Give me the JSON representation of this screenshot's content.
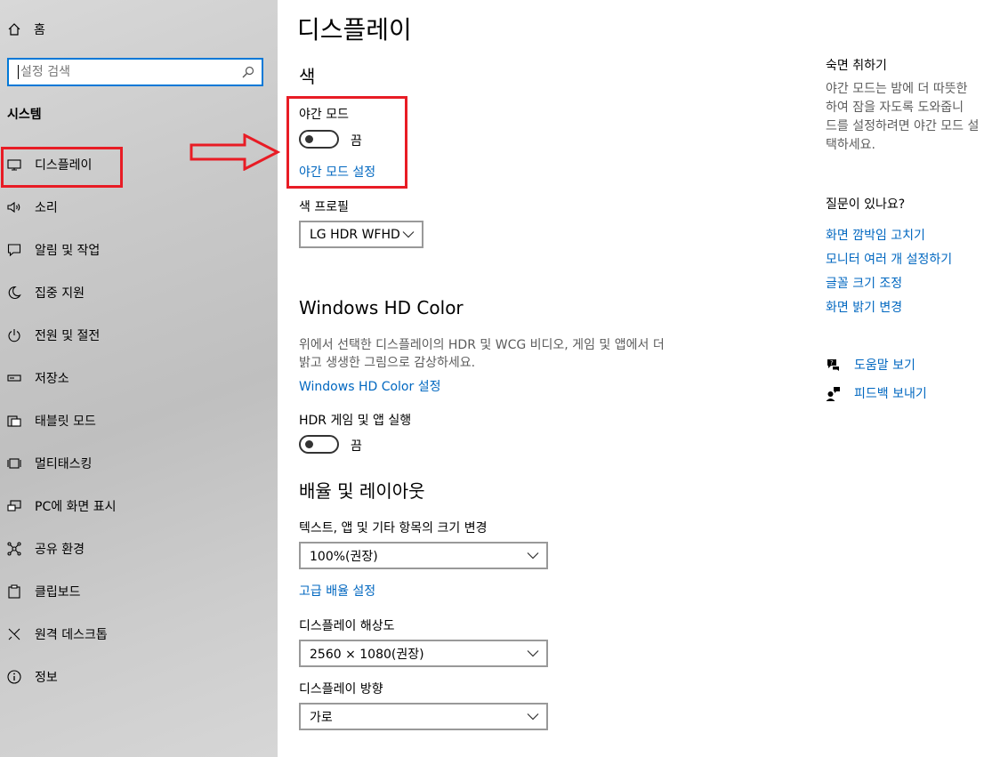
{
  "sidebar": {
    "home_label": "홈",
    "search_placeholder": "설정 검색",
    "section_label": "시스템",
    "items": [
      {
        "label": "디스플레이",
        "icon": "monitor-icon"
      },
      {
        "label": "소리",
        "icon": "speaker-icon"
      },
      {
        "label": "알림 및 작업",
        "icon": "notification-icon"
      },
      {
        "label": "집중 지원",
        "icon": "moon-icon"
      },
      {
        "label": "전원 및 절전",
        "icon": "power-icon"
      },
      {
        "label": "저장소",
        "icon": "storage-icon"
      },
      {
        "label": "태블릿 모드",
        "icon": "tablet-icon"
      },
      {
        "label": "멀티태스킹",
        "icon": "multitasking-icon"
      },
      {
        "label": "PC에 화면 표시",
        "icon": "project-icon"
      },
      {
        "label": "공유 환경",
        "icon": "share-icon"
      },
      {
        "label": "클립보드",
        "icon": "clipboard-icon"
      },
      {
        "label": "원격 데스크톱",
        "icon": "remote-desktop-icon"
      },
      {
        "label": "정보",
        "icon": "info-icon"
      }
    ]
  },
  "main": {
    "title": "디스플레이",
    "color_section": {
      "heading": "색",
      "night_mode_label": "야간 모드",
      "night_mode_state": "끔",
      "night_mode_link": "야간 모드 설정",
      "profile_label": "색 프로필",
      "profile_value": "LG HDR WFHD"
    },
    "hd_color_section": {
      "heading": "Windows HD Color",
      "description_line1": "위에서 선택한 디스플레이의 HDR 및 WCG 비디오, 게임 및 앱에서 더",
      "description_line2": "밝고 생생한 그림으로 감상하세요.",
      "link": "Windows HD Color 설정",
      "hdr_label": "HDR 게임 및 앱 실행",
      "hdr_state": "끔"
    },
    "layout_section": {
      "heading": "배율 및 레이아웃",
      "scale_label": "텍스트, 앱 및 기타 항목의 크기 변경",
      "scale_value": "100%(권장)",
      "advanced_link": "고급 배율 설정",
      "resolution_label": "디스플레이 해상도",
      "resolution_value": "2560 × 1080(권장)",
      "orientation_label": "디스플레이 방향",
      "orientation_value": "가로"
    }
  },
  "right_column": {
    "sleep_title": "숙면 취하기",
    "sleep_desc_lines": [
      "야간 모드는 밤에 더 따뜻한",
      "하여 잠을 자도록 도와줍니",
      "드를 설정하려면 야간 모드 설",
      "택하세요."
    ],
    "question_title": "질문이 있나요?",
    "links": [
      "화면 깜박임 고치기",
      "모니터 여러 개 설정하기",
      "글꼴 크기 조정",
      "화면 밝기 변경"
    ],
    "help_label": "도움말 보기",
    "feedback_label": "피드백 보내기"
  },
  "colors": {
    "accent": "#0067c0",
    "annotation": "#e81c25",
    "search_border": "#0078d7"
  }
}
